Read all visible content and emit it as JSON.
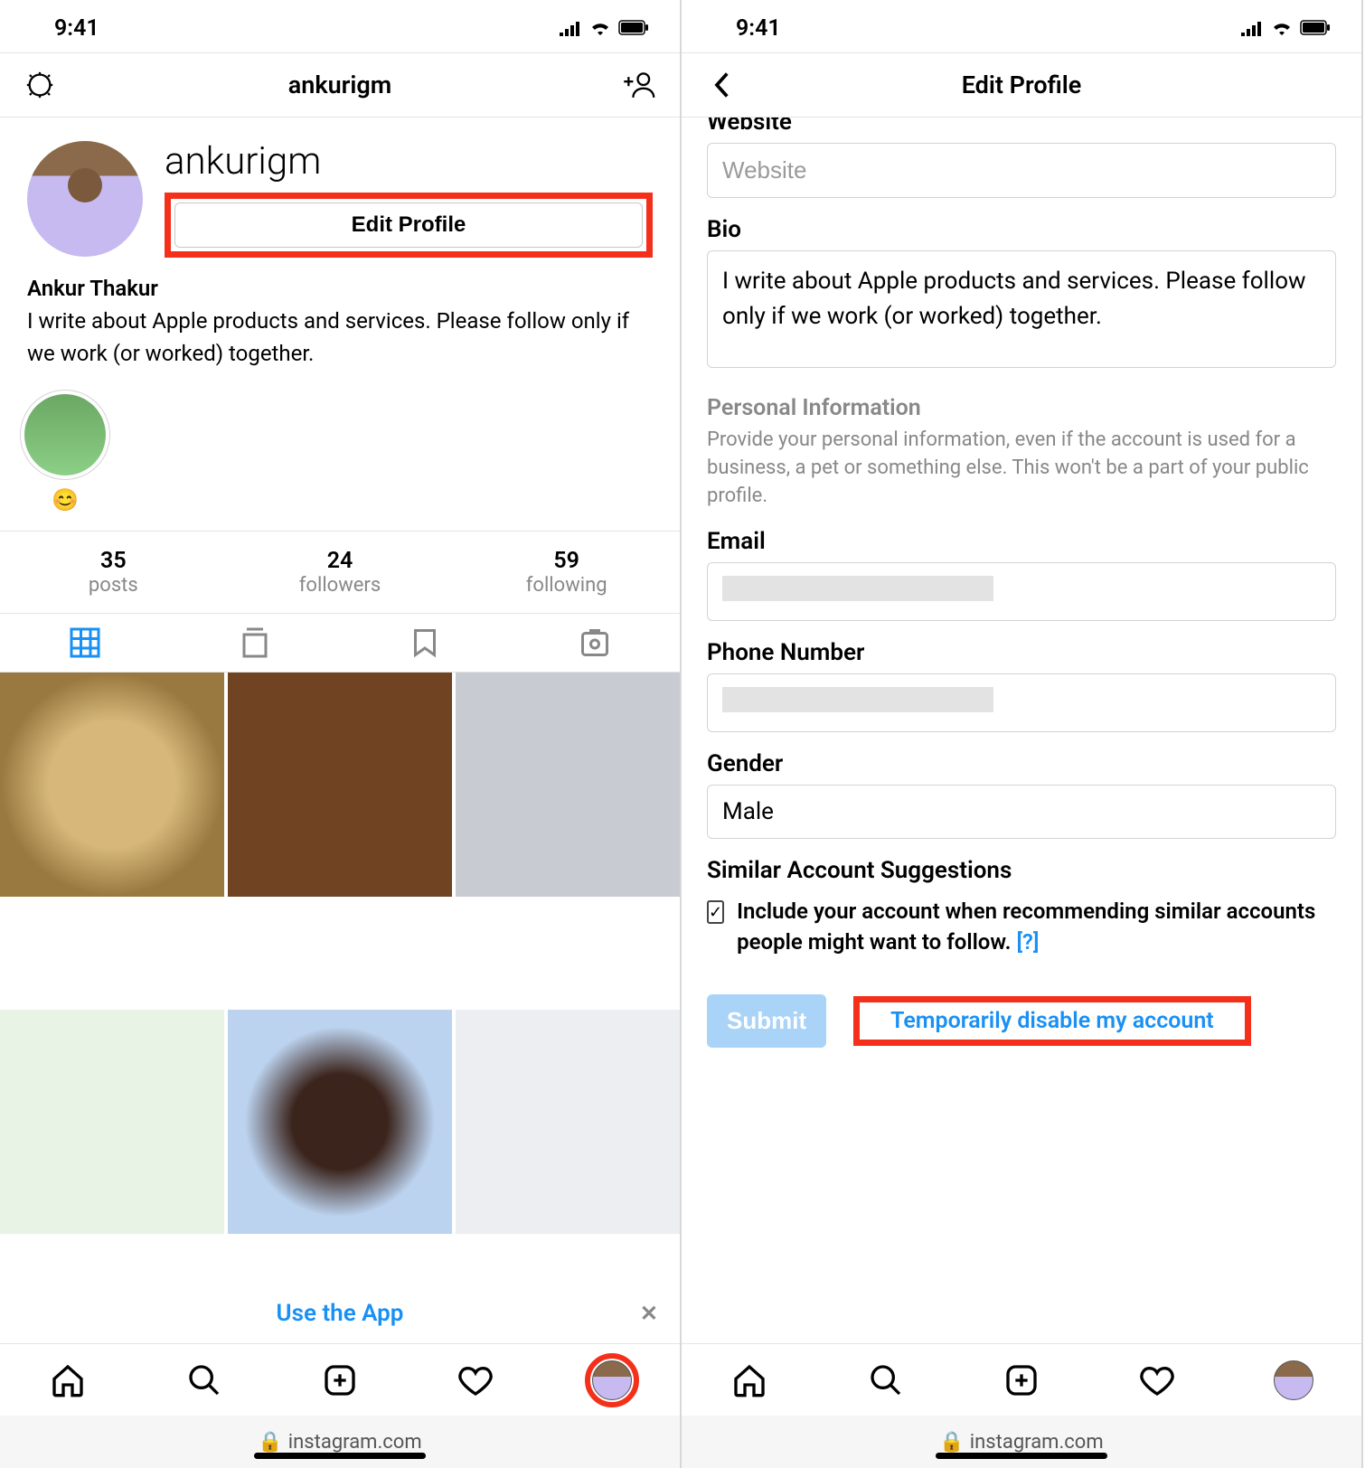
{
  "status": {
    "time": "9:41"
  },
  "left": {
    "nav": {
      "title": "ankurigm"
    },
    "profile": {
      "username": "ankurigm",
      "edit_button": "Edit Profile",
      "display_name": "Ankur Thakur",
      "bio": "I write about Apple products and services. Please follow only if we work (or worked) together.",
      "highlight_emoji": "😊"
    },
    "stats": {
      "posts": {
        "num": "35",
        "label": "posts"
      },
      "followers": {
        "num": "24",
        "label": "followers"
      },
      "following": {
        "num": "59",
        "label": "following"
      }
    },
    "banner": {
      "text": "Use the App"
    },
    "footer": {
      "url": "instagram.com"
    }
  },
  "right": {
    "nav": {
      "title": "Edit Profile"
    },
    "form": {
      "website_label": "Website",
      "website_placeholder": "Website",
      "bio_label": "Bio",
      "bio_value": "I write about Apple products and services. Please follow only if we work (or worked) together.",
      "personal_info_heading": "Personal Information",
      "personal_info_desc": "Provide your personal information, even if the account is used for a business, a pet or something else. This won't be a part of your public profile.",
      "email_label": "Email",
      "phone_label": "Phone Number",
      "gender_label": "Gender",
      "gender_value": "Male",
      "similar_heading": "Similar Account Suggestions",
      "similar_text": "Include your account when recommending similar accounts people might want to follow.",
      "similar_help": "[?]",
      "submit": "Submit",
      "disable": "Temporarily disable my account"
    },
    "footer": {
      "url": "instagram.com"
    }
  }
}
